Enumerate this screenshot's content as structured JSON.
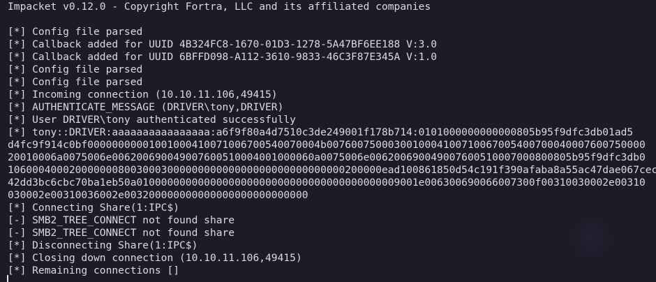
{
  "terminal": {
    "banner": "Impacket v0.12.0 - Copyright Fortra, LLC and its affiliated companies",
    "lines": [
      "[*] Config file parsed",
      "[*] Callback added for UUID 4B324FC8-1670-01D3-1278-5A47BF6EE188 V:3.0",
      "[*] Callback added for UUID 6BFFD098-A112-3610-9833-46C3F87E345A V:1.0",
      "[*] Config file parsed",
      "[*] Config file parsed",
      "[*] Incoming connection (10.10.11.106,49415)",
      "[*] AUTHENTICATE_MESSAGE (DRIVER\\tony,DRIVER)",
      "[*] User DRIVER\\tony authenticated successfully",
      "[*] tony::DRIVER:aaaaaaaaaaaaaaaa:a6f9f80a4d7510c3de249001f178b714:0101000000000000805b95f9dfc3db01ad5",
      "d4fc9f914c0bf00000000001001000410071006700540070004b0076007500030010004100710067005400700040007600750000",
      "20010006a0075006e006200690049007600510004001000060a0075006e006200690049007600510007000800805b95f9dfc3db0",
      "1060004000200000008003000300000000000000000000000000000200000ead100861850d54c191f390afaba8a55ac47dae067cec",
      "42dd3bc6cbc70ba1eb50a0100000000000000000000000000000000000000009001e006300690066007300f00310030002e00310",
      "030002e00310036002e003200000000000000000000000000",
      "[*] Connecting Share(1:IPC$)",
      "[-] SMB2_TREE_CONNECT not found share",
      "[-] SMB2_TREE_CONNECT not found share",
      "[*] Disconnecting Share(1:IPC$)",
      "[*] Closing down connection (10.10.11.106,49415)",
      "[*] Remaining connections []"
    ]
  },
  "colors": {
    "background": "#1c1b28",
    "text": "#dcdcdc"
  }
}
